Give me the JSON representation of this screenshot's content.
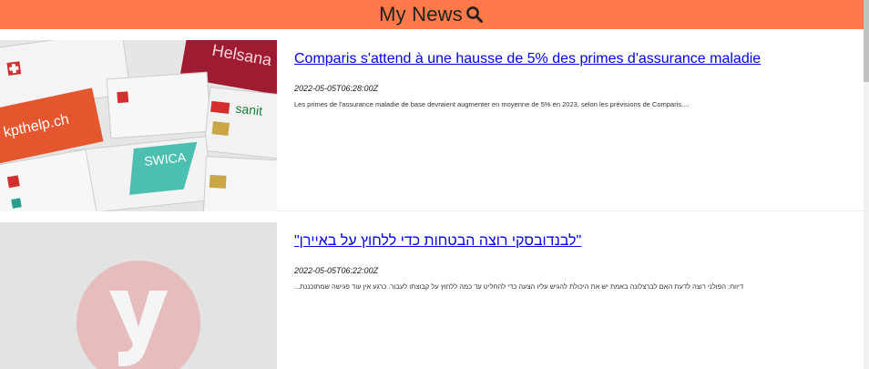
{
  "header": {
    "title": "My News",
    "search_icon": "search-icon",
    "background": "#ff7a4a"
  },
  "articles": [
    {
      "headline": "Comparis s'attend à une hausse de 5% des primes d'assurance maladie",
      "timestamp": "2022-05-05T06:28:00Z",
      "summary": "Les primes de l'assurance maladie de base devraient augmenter en moyenne de 5% en 2023, selon les prévisions de Comparis....",
      "image": "health-insurance-cards-photo"
    },
    {
      "headline": "\"לבנדובסקי רוצה הבטחות כדי ללחוץ על באיירן\"",
      "timestamp": "2022-05-05T06:22:00Z",
      "summary": "דיווח: הפולני רוצה לדעת האם לברצלונה באמת יש את היכולת להגיש עליו הצעה כדי להחליט עד כמה ללחוץ על קבוצתו לעבור. כרגע אין עוד פגישה שמתוכננת...",
      "image": "ynet-logo-placeholder"
    }
  ]
}
